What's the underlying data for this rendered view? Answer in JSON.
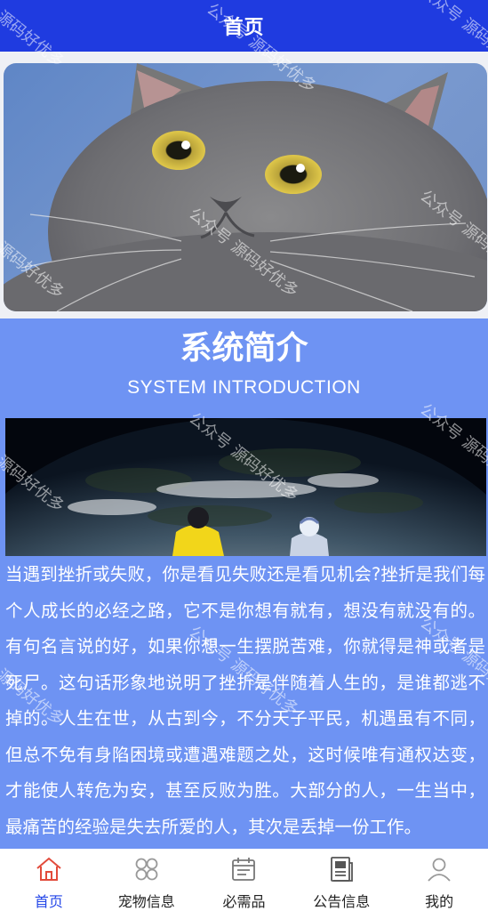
{
  "header": {
    "title": "首页"
  },
  "intro": {
    "title": "系统简介",
    "subtitle": "SYSTEM INTRODUCTION",
    "text": "当遇到挫折或失败，你是看见失败还是看见机会?挫折是我们每个人成长的必经之路，它不是你想有就有，想没有就没有的。有句名言说的好，如果你想一生摆脱苦难，你就得是神或者是死尸。这句话形象地说明了挫折是伴随着人生的，是谁都逃不掉的。人生在世，从古到今，不分天子平民，机遇虽有不同，但总不免有身陷困境或遭遇难题之处，这时候唯有通权达变，才能使人转危为安，甚至反败为胜。大部分的人，一生当中，最痛苦的经验是失去所爱的人，其次是丢掉一份工作。"
  },
  "tabbar": {
    "items": [
      {
        "label": "首页",
        "icon": "home-icon",
        "active": true
      },
      {
        "label": "宠物信息",
        "icon": "grid-icon",
        "active": false
      },
      {
        "label": "必需品",
        "icon": "calendar-icon",
        "active": false
      },
      {
        "label": "公告信息",
        "icon": "newspaper-icon",
        "active": false
      },
      {
        "label": "我的",
        "icon": "user-icon",
        "active": false
      }
    ]
  },
  "watermarks": {
    "a": "源码好优多",
    "b": "公众号 源码好优多"
  },
  "colors": {
    "header": "#1f3be0",
    "intro_bg": "#6e93f3",
    "active_tab": "#2346e8",
    "active_icon": "#e24b3b"
  }
}
